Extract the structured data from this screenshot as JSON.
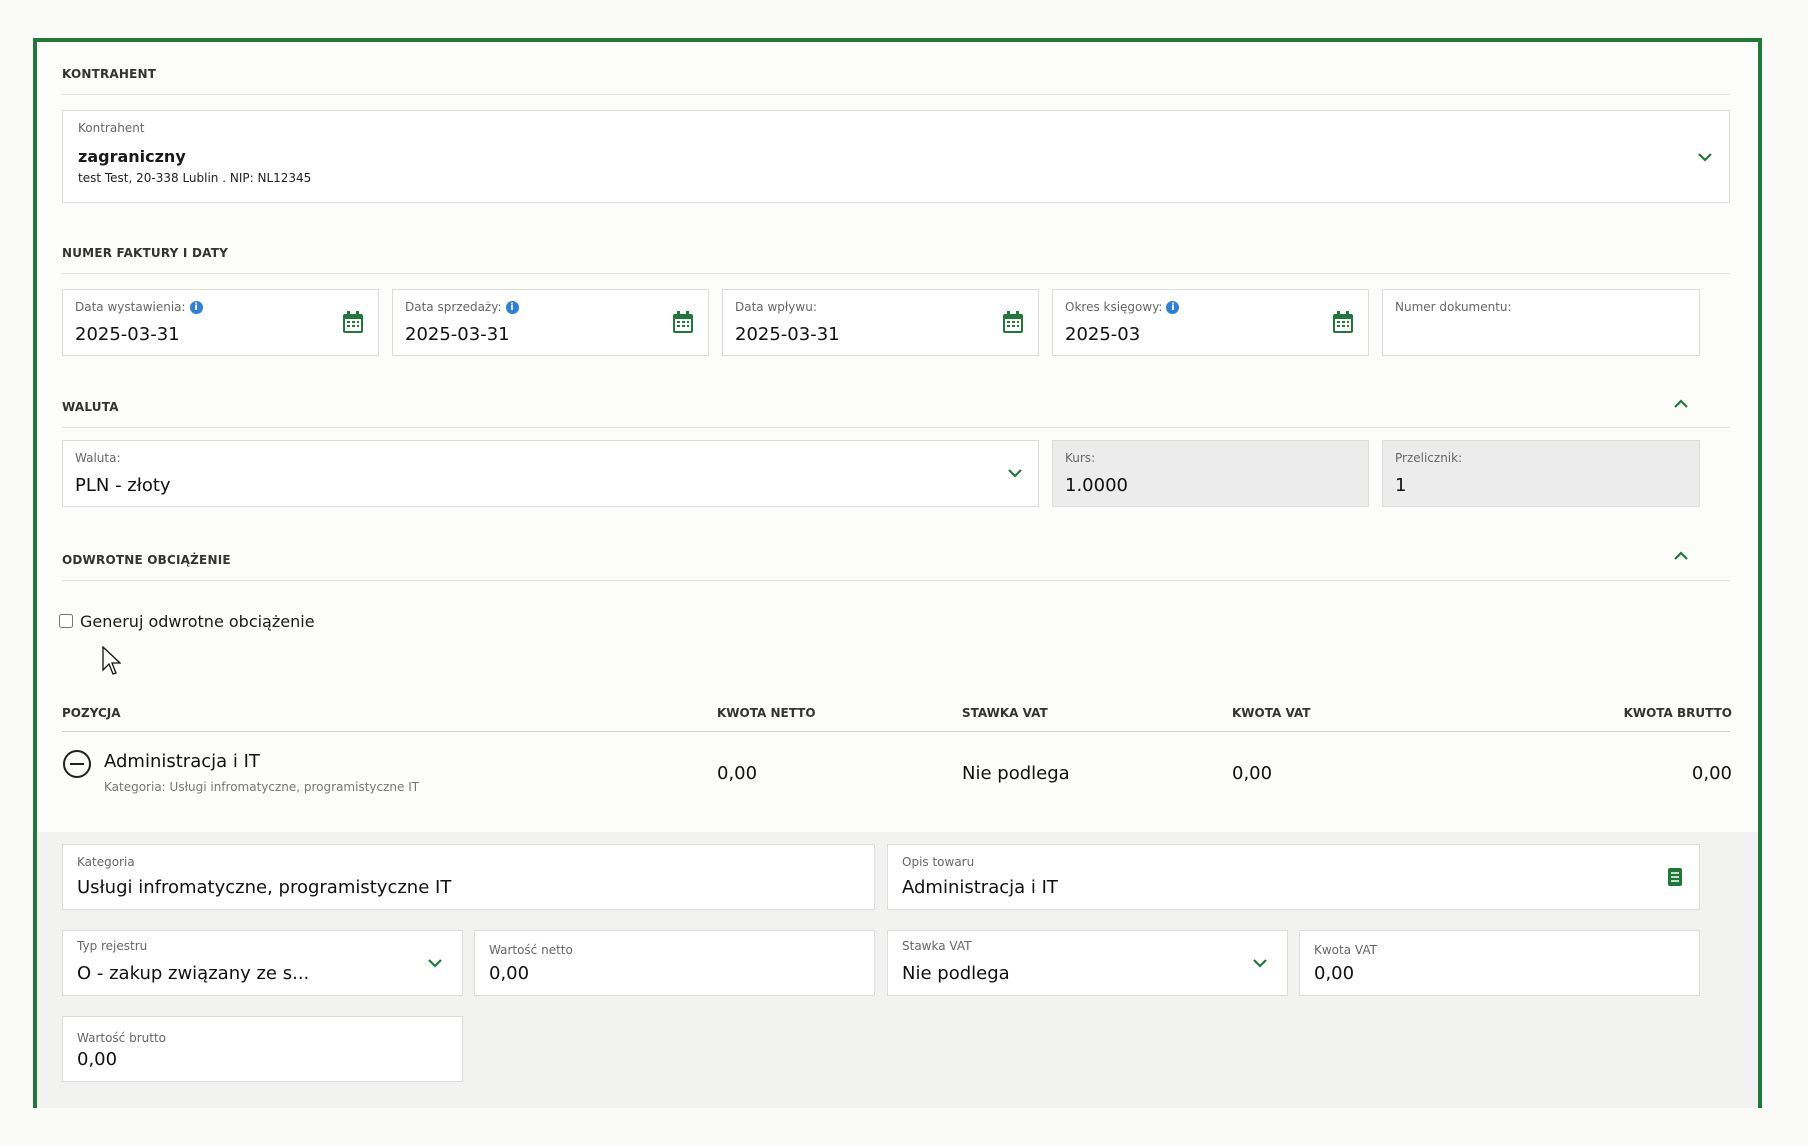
{
  "contractor": {
    "section_title": "KONTRAHENT",
    "label": "Kontrahent",
    "name": "zagraniczny",
    "details": "test Test, 20-338 Lublin . NIP: NL12345"
  },
  "invoice": {
    "section_title": "NUMER FAKTURY I DATY",
    "fields": [
      {
        "label": "Data wystawienia:",
        "value": "2025-03-31"
      },
      {
        "label": "Data sprzedaży:",
        "value": "2025-03-31"
      },
      {
        "label": "Data wpływu:",
        "value": "2025-03-31"
      },
      {
        "label": "Okres księgowy:",
        "value": "2025-03"
      },
      {
        "label": "Numer dokumentu:",
        "value": ""
      }
    ]
  },
  "currency": {
    "section_title": "WALUTA",
    "currency_label": "Waluta:",
    "currency_value": "PLN - złoty",
    "rate_label": "Kurs:",
    "rate_value": "1.0000",
    "converter_label": "Przelicznik:",
    "converter_value": "1"
  },
  "reverse_charge": {
    "section_title": "ODWROTNE OBCIĄŻENIE",
    "checkbox_label": "Generuj odwrotne obciążenie",
    "checked": false
  },
  "items_table": {
    "headers": {
      "position": "POZYCJA",
      "net": "KWOTA NETTO",
      "vat_rate": "STAWKA VAT",
      "vat": "KWOTA VAT",
      "gross": "KWOTA BRUTTO"
    },
    "row": {
      "name": "Administracja i IT",
      "category": "Kategoria: Usługi infromatyczne, programistyczne IT",
      "net": "0,00",
      "vat_rate": "Nie podlega",
      "vat": "0,00",
      "gross": "0,00"
    }
  },
  "item_detail": {
    "category_label": "Kategoria",
    "category_value": "Usługi  infromatyczne, programistyczne IT",
    "desc_label": "Opis towaru",
    "desc_value": "Administracja i IT",
    "register_label": "Typ rejestru",
    "register_value": "O - zakup związany ze s...",
    "net_label": "Wartość netto",
    "net_value": "0,00",
    "vat_rate_label": "Stawka VAT",
    "vat_rate_value": "Nie podlega",
    "vat_label": "Kwota VAT",
    "vat_value": "0,00",
    "gross_label": "Wartość brutto",
    "gross_value": "0,00"
  },
  "colors": {
    "accent": "#1f7a3a",
    "info": "#2d7fe0"
  }
}
